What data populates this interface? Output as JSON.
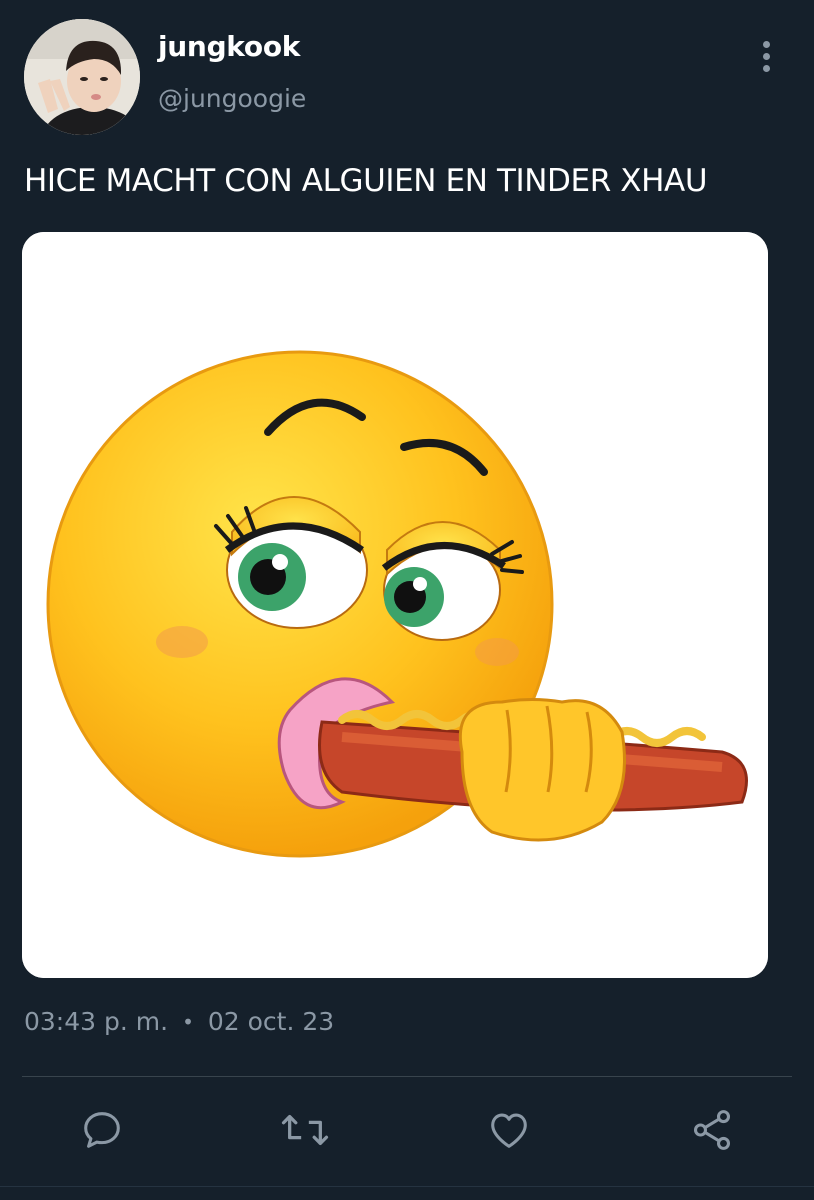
{
  "author": {
    "display_name": "jungkook",
    "handle": "@jungoogie",
    "avatar_icon": "profile-photo"
  },
  "tweet": {
    "text": "HICE MACHT CON ALGUIEN EN TINDER XHAU",
    "media_icon": "emoji-eating-hotdog-image",
    "time": "03:43 p. m.",
    "separator": "•",
    "date": "02 oct. 23"
  },
  "actions": [
    {
      "name": "reply",
      "icon": "reply-icon"
    },
    {
      "name": "retweet",
      "icon": "retweet-icon"
    },
    {
      "name": "like",
      "icon": "heart-icon"
    },
    {
      "name": "share",
      "icon": "share-icon"
    }
  ],
  "colors": {
    "background": "#15202b",
    "text_primary": "#ffffff",
    "text_secondary": "#8b98a5",
    "divider": "#38444d"
  }
}
